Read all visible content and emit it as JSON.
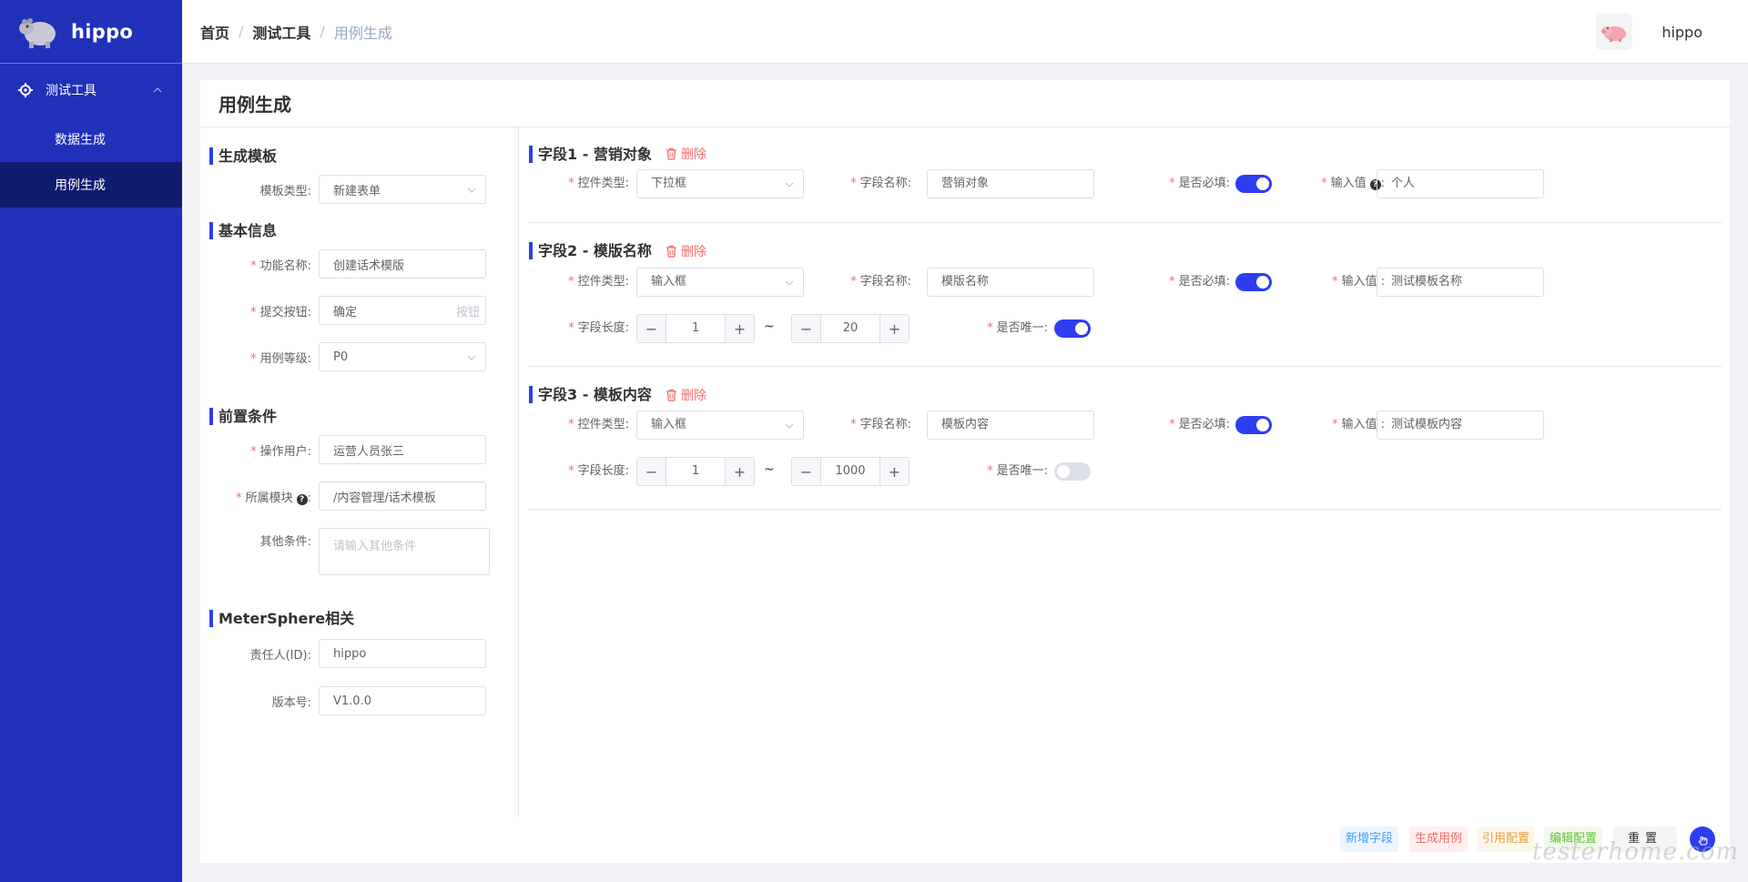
{
  "app": {
    "name": "hippo"
  },
  "sidebar": {
    "group_label": "测试工具",
    "items": [
      {
        "label": "数据生成",
        "active": false
      },
      {
        "label": "用例生成",
        "active": true
      }
    ]
  },
  "breadcrumb": {
    "home": "首页",
    "section": "测试工具",
    "current": "用例生成",
    "separator": "/"
  },
  "user": {
    "name": "hippo"
  },
  "page": {
    "title": "用例生成"
  },
  "left": {
    "template_section": "生成模板",
    "template_type_label": "模板类型",
    "template_type_value": "新建表单",
    "basic_section": "基本信息",
    "func_name_label": "功能名称",
    "func_name_value": "创建话术模版",
    "submit_label": "提交按钮",
    "submit_value": "确定",
    "submit_suffix": "按钮",
    "level_label": "用例等级",
    "level_value": "P0",
    "pre_section": "前置条件",
    "operator_label": "操作用户",
    "operator_value": "运营人员张三",
    "module_label": "所属模块",
    "module_value": "/内容管理/话术模板",
    "other_label": "其他条件",
    "other_placeholder": "请输入其他条件",
    "ms_section": "MeterSphere相关",
    "owner_label": "责任人(ID)",
    "owner_value": "hippo",
    "version_label": "版本号",
    "version_value": "V1.0.0"
  },
  "labels": {
    "control_type": "控件类型",
    "field_name": "字段名称",
    "required": "是否必填",
    "input_value": "输入值",
    "field_length": "字段长度",
    "unique": "是否唯一",
    "delete": "删除",
    "tilde": "~"
  },
  "fields": [
    {
      "title": "字段1 - 营销对象",
      "control_type": "下拉框",
      "field_name": "营销对象",
      "required": true,
      "input_value": "个人"
    },
    {
      "title": "字段2 - 模版名称",
      "control_type": "输入框",
      "field_name": "模版名称",
      "required": true,
      "input_value": "测试模板名称",
      "length_min": "1",
      "length_max": "20",
      "unique": true
    },
    {
      "title": "字段3 - 模板内容",
      "control_type": "输入框",
      "field_name": "模板内容",
      "required": true,
      "input_value": "测试模板内容",
      "length_min": "1",
      "length_max": "1000",
      "unique": false
    }
  ],
  "actions": {
    "add_field": "新增字段",
    "generate": "生成用例",
    "reference": "引用配置",
    "edit": "编辑配置",
    "reset": "重置"
  },
  "watermark": "testerhome.com",
  "colors": {
    "sidebar": "#2130b8",
    "sidebar_active": "#111b6e",
    "accent": "#2d3ef0",
    "danger": "#f56c6c"
  }
}
